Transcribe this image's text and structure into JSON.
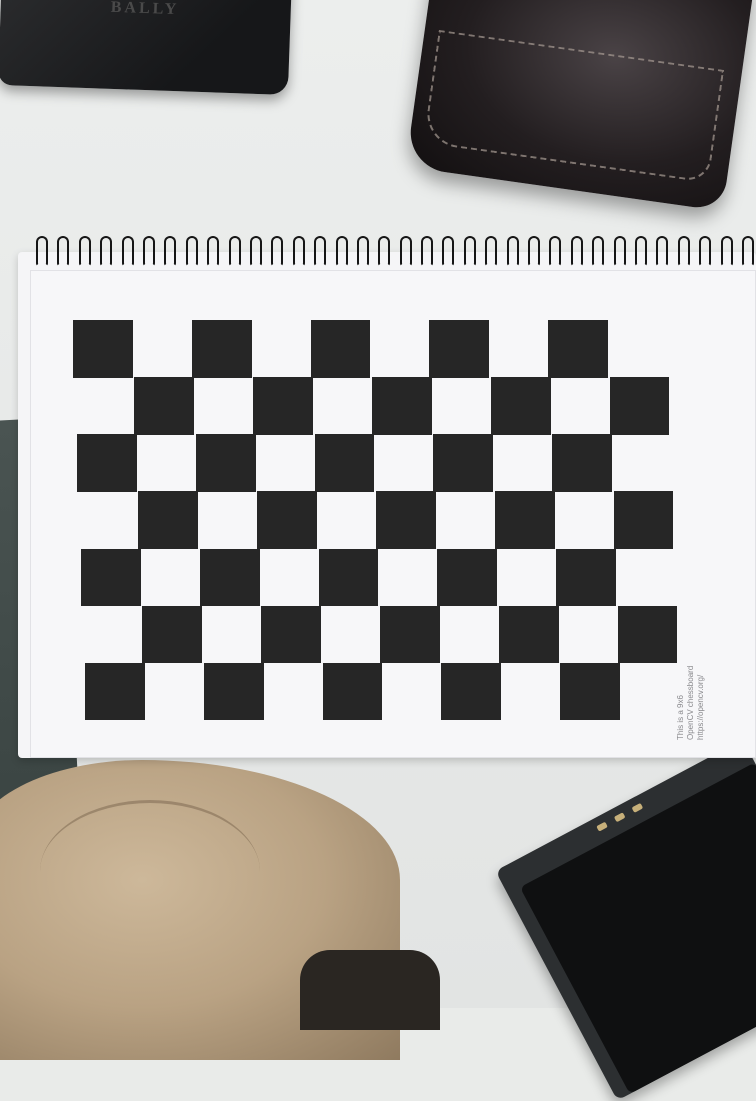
{
  "wallet_logo": "BALLY",
  "chessboard": {
    "rows": 7,
    "cols": 10,
    "dark_color": "#262626",
    "light_color": "#f7f7f9"
  },
  "caption": {
    "line1": "This is a 9x6",
    "line2": "OpenCV chessboard",
    "line3": "https://opencv.org/"
  }
}
